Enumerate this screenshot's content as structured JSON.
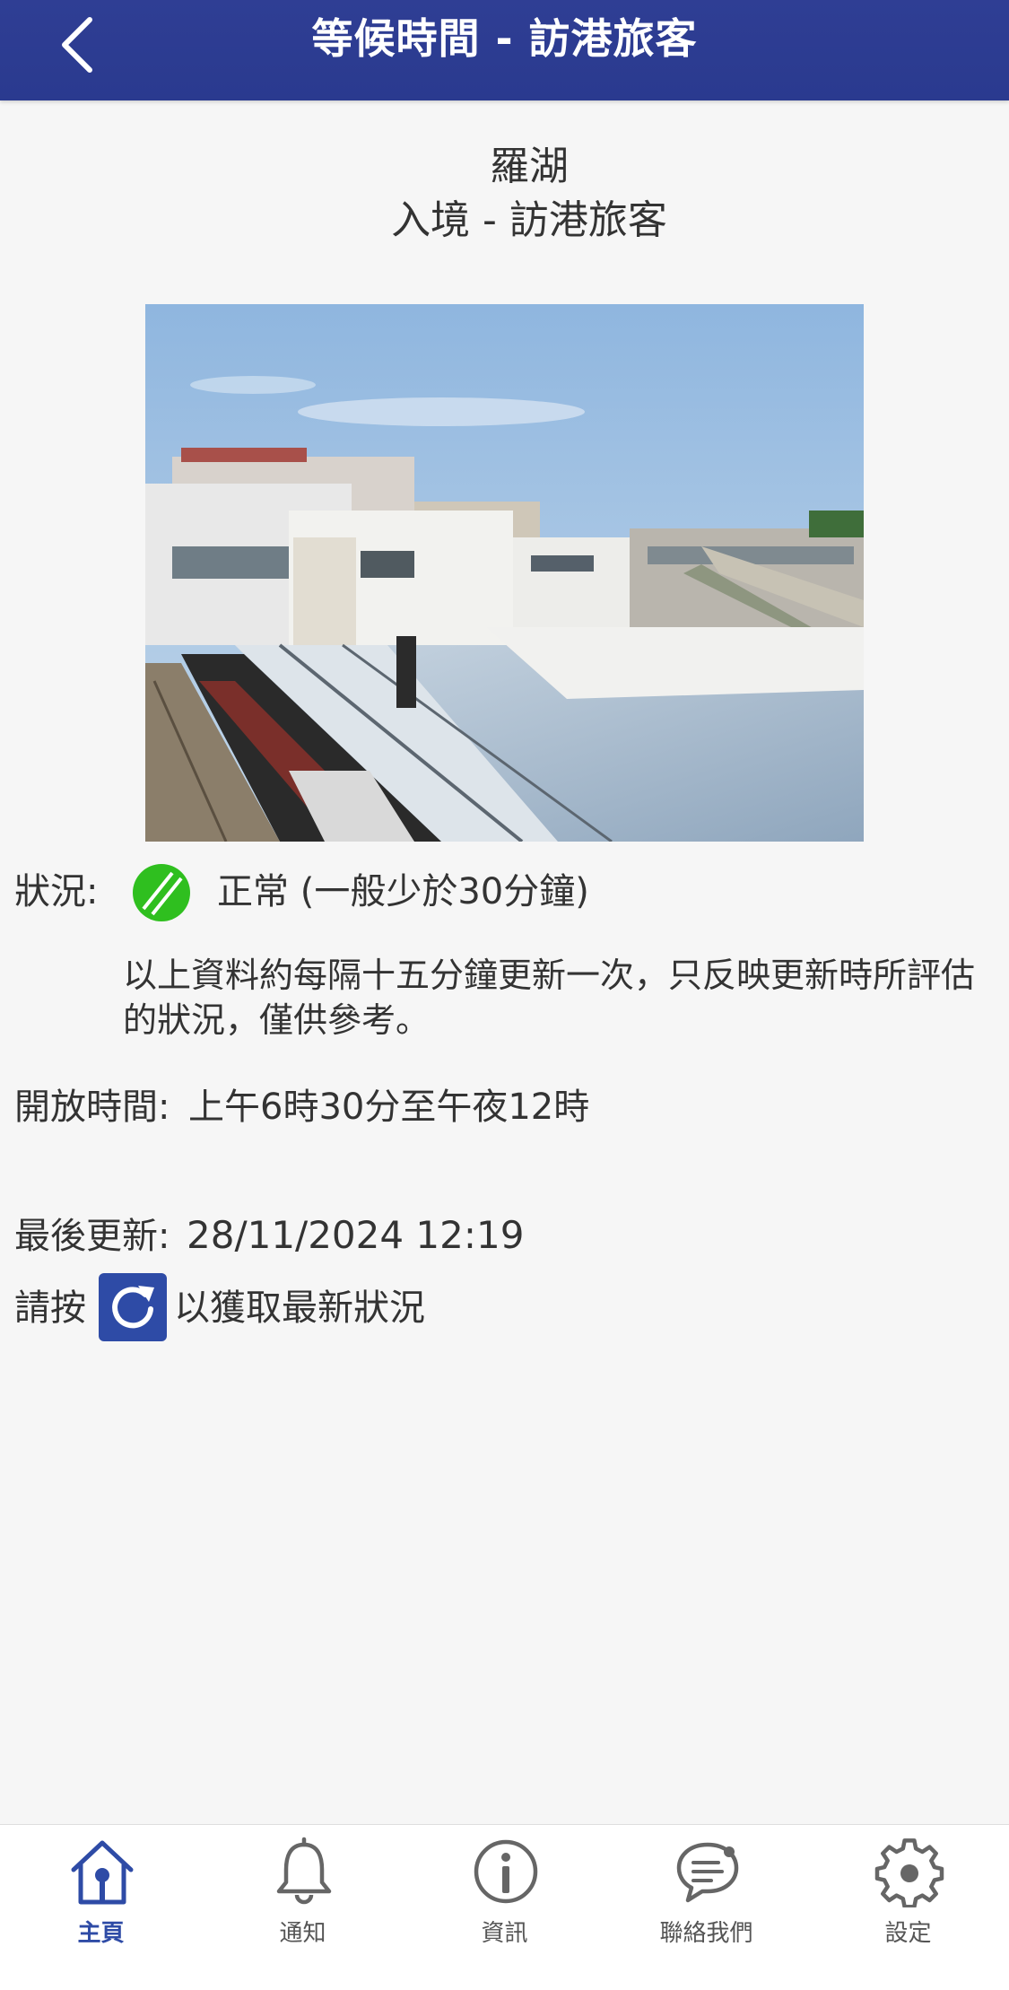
{
  "header": {
    "title": "等候時間 - 訪港旅客"
  },
  "location": {
    "name": "羅湖",
    "direction": "入境 - 訪港旅客"
  },
  "status": {
    "label": "狀況:",
    "value": "正常 (一般少於30分鐘)",
    "indicator_color": "#2fbf1f"
  },
  "update_note": "以上資料約每隔十五分鐘更新一次，只反映更新時所評估的狀況，僅供參考。",
  "hours": {
    "label": "開放時間:",
    "value": "上午6時30分至午夜12時"
  },
  "last_update": {
    "label": "最後更新:",
    "value": "28/11/2024 12:19"
  },
  "refresh_hint": {
    "prefix": "請按",
    "suffix": "以獲取最新狀況"
  },
  "tabs": [
    {
      "label": "主頁",
      "icon": "home-icon",
      "active": true
    },
    {
      "label": "通知",
      "icon": "bell-icon",
      "active": false
    },
    {
      "label": "資訊",
      "icon": "info-icon",
      "active": false
    },
    {
      "label": "聯絡我們",
      "icon": "chat-icon",
      "active": false
    },
    {
      "label": "設定",
      "icon": "gear-icon",
      "active": false
    }
  ],
  "colors": {
    "header": "#2f3e94",
    "accent": "#2e4ba6",
    "background": "#f6f6f6"
  }
}
